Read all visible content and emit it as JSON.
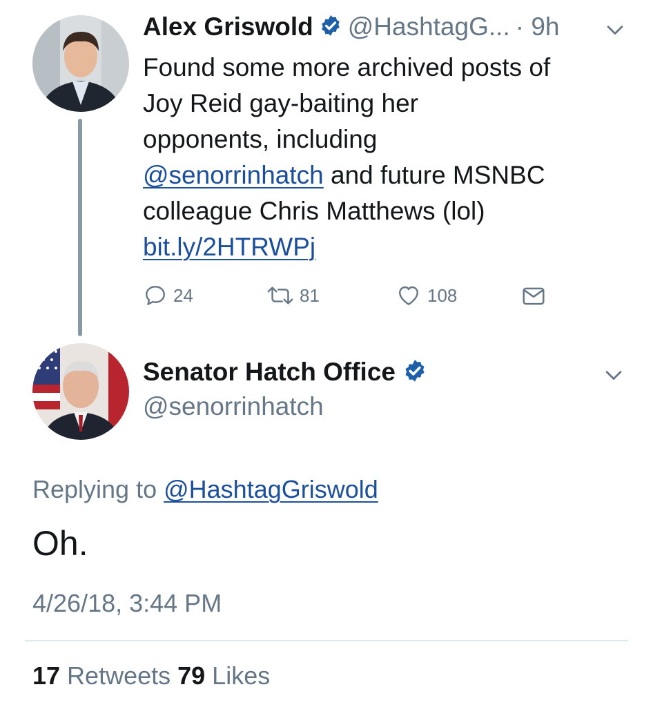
{
  "tweet1": {
    "author_name": "Alex Griswold",
    "author_handle": "@HashtagG...",
    "time": "· 9h",
    "text_line1": "Found some more archived posts of",
    "text_line2": "Joy Reid gay-baiting her",
    "text_line3": "opponents, including",
    "mention": "@senorrinhatch",
    "text_line4_rest": " and future MSNBC",
    "text_line5": "colleague Chris Matthews (lol)",
    "link": "bit.ly/2HTRWPj",
    "actions": {
      "replies": "24",
      "retweets": "81",
      "likes": "108"
    },
    "icons": [
      "verified-icon",
      "chevron-down-icon",
      "reply-icon",
      "retweet-icon",
      "like-icon",
      "message-icon"
    ]
  },
  "tweet2": {
    "author_name": "Senator Hatch Office",
    "author_handle": "@senorrinhatch",
    "replying_prefix": "Replying to ",
    "replying_to": "@HashtagGriswold",
    "text": "Oh.",
    "timestamp": "4/26/18, 3:44 PM",
    "retweet_count": "17",
    "retweet_label": " Retweets ",
    "like_count": "79",
    "like_label": " Likes"
  },
  "colors": {
    "link": "#1b4f9b",
    "verified": "#1d5fa8",
    "muted": "#657786",
    "thread_line": "#8899a6"
  }
}
